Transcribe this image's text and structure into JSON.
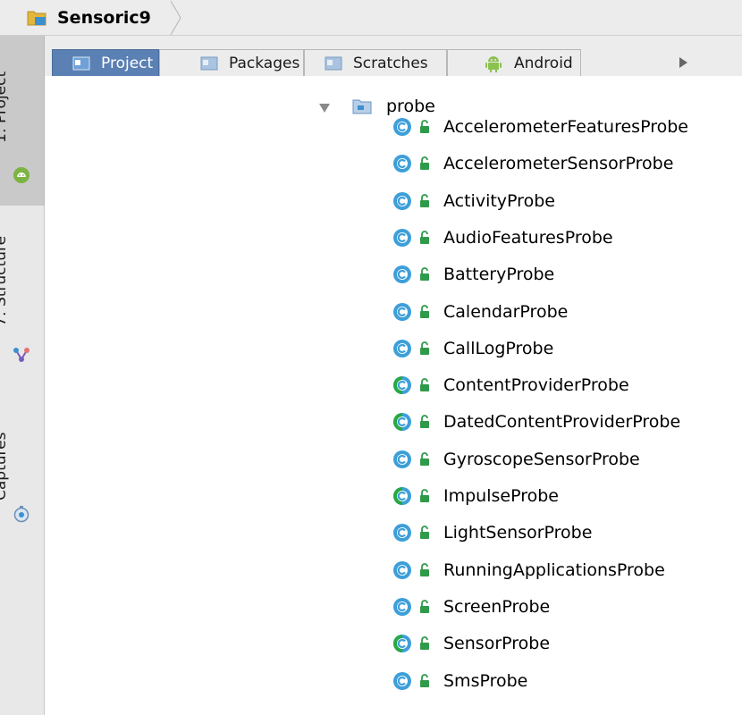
{
  "breadcrumb": {
    "project_name": "Sensoric9"
  },
  "side_tabs": [
    {
      "label": "1: Project",
      "icon": "android-icon",
      "active": true
    },
    {
      "label": "7: Structure",
      "icon": "structure-icon",
      "active": false
    },
    {
      "label": "Captures",
      "icon": "captures-icon",
      "active": false
    }
  ],
  "view_tabs": [
    {
      "label": "Project",
      "icon": "project-view-icon",
      "active": true
    },
    {
      "label": "Packages",
      "icon": "packages-view-icon",
      "active": false
    },
    {
      "label": "Scratches",
      "icon": "scratches-view-icon",
      "active": false
    },
    {
      "label": "Android",
      "icon": "android-view-icon",
      "active": false
    }
  ],
  "tree": {
    "package": {
      "name": "probe",
      "expanded": true
    },
    "classes": [
      {
        "name": "AccelerometerFeaturesProbe",
        "kind": "class"
      },
      {
        "name": "AccelerometerSensorProbe",
        "kind": "class"
      },
      {
        "name": "ActivityProbe",
        "kind": "class"
      },
      {
        "name": "AudioFeaturesProbe",
        "kind": "class"
      },
      {
        "name": "BatteryProbe",
        "kind": "class"
      },
      {
        "name": "CalendarProbe",
        "kind": "class"
      },
      {
        "name": "CallLogProbe",
        "kind": "class"
      },
      {
        "name": "ContentProviderProbe",
        "kind": "abstract"
      },
      {
        "name": "DatedContentProviderProbe",
        "kind": "abstract"
      },
      {
        "name": "GyroscopeSensorProbe",
        "kind": "class"
      },
      {
        "name": "ImpulseProbe",
        "kind": "abstract"
      },
      {
        "name": "LightSensorProbe",
        "kind": "class"
      },
      {
        "name": "RunningApplicationsProbe",
        "kind": "class"
      },
      {
        "name": "ScreenProbe",
        "kind": "class"
      },
      {
        "name": "SensorProbe",
        "kind": "abstract"
      },
      {
        "name": "SmsProbe",
        "kind": "class"
      }
    ]
  },
  "colors": {
    "class_icon": "#3d9fd9",
    "abstract_accent": "#27a844",
    "lock": "#2f9a4a",
    "active_tab": "#5b80b3"
  }
}
